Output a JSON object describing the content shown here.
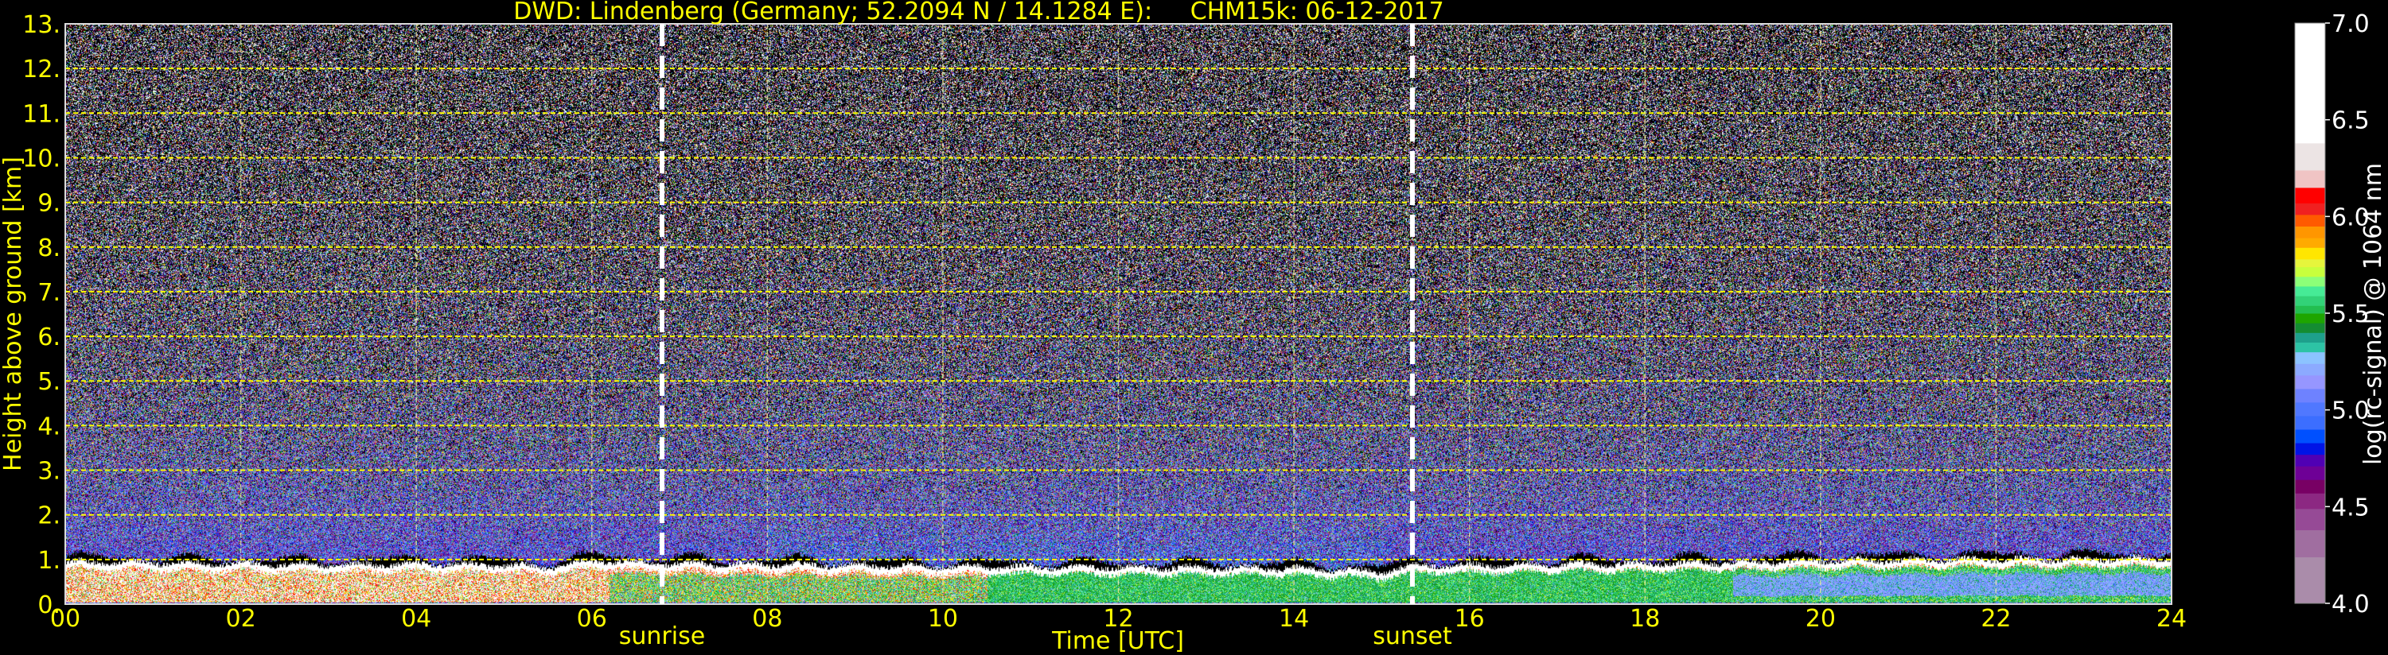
{
  "chart_data": {
    "type": "heatmap",
    "title": "DWD: Lindenberg (Germany; 52.2094 N / 14.1284 E):     CHM15k: 06-12-2017",
    "xlabel": "Time [UTC]",
    "ylabel": "Height above ground [km]",
    "xlim": [
      0,
      24
    ],
    "ylim": [
      0,
      13
    ],
    "grid": true,
    "x_ticks": [
      0,
      2,
      4,
      6,
      8,
      10,
      12,
      14,
      16,
      18,
      20,
      22,
      24
    ],
    "x_tick_labels": [
      "00",
      "02",
      "04",
      "06",
      "08",
      "10",
      "12",
      "14",
      "16",
      "18",
      "20",
      "22",
      "24"
    ],
    "y_ticks": [
      0,
      1,
      2,
      3,
      4,
      5,
      6,
      7,
      8,
      9,
      10,
      11,
      12,
      13
    ],
    "y_tick_labels": [
      "0.",
      "1.",
      "2.",
      "3.",
      "4.",
      "5.",
      "6.",
      "7.",
      "8.",
      "9.",
      "10.",
      "11.",
      "12.",
      "13."
    ],
    "annotations": [
      {
        "label": "sunrise",
        "x": 6.8
      },
      {
        "label": "sunset",
        "x": 15.35
      }
    ],
    "boundary_layer_top_km": [
      [
        0,
        0.92
      ],
      [
        1,
        0.9
      ],
      [
        2,
        0.88
      ],
      [
        3,
        0.85
      ],
      [
        4,
        0.88
      ],
      [
        5,
        0.85
      ],
      [
        5.5,
        0.8
      ],
      [
        6,
        0.95
      ],
      [
        7,
        0.88
      ],
      [
        8,
        0.87
      ],
      [
        9,
        0.85
      ],
      [
        10,
        0.82
      ],
      [
        12,
        0.8
      ],
      [
        14,
        0.78
      ],
      [
        15,
        0.7
      ],
      [
        15.4,
        0.85
      ],
      [
        16,
        0.85
      ],
      [
        18,
        0.88
      ],
      [
        20,
        0.95
      ],
      [
        22,
        0.98
      ],
      [
        24,
        1.0
      ]
    ],
    "colorbar": {
      "label": "log(rc-signal) @ 1064 nm",
      "range": [
        4.0,
        7.0
      ],
      "ticks": [
        4.0,
        4.5,
        5.0,
        5.5,
        6.0,
        6.5,
        7.0
      ],
      "tick_labels": [
        "4.0",
        "4.5",
        "5.0",
        "5.5",
        "6.0",
        "6.5",
        "7.0"
      ],
      "bins": [
        {
          "from": 4.0,
          "color": "#aa8caa"
        },
        {
          "from": 4.24,
          "color": "#a06ea0"
        },
        {
          "from": 4.38,
          "color": "#964a96"
        },
        {
          "from": 4.49,
          "color": "#8c2882"
        },
        {
          "from": 4.57,
          "color": "#780064"
        },
        {
          "from": 4.64,
          "color": "#6e0096"
        },
        {
          "from": 4.71,
          "color": "#5000b4"
        },
        {
          "from": 4.77,
          "color": "#0014e6"
        },
        {
          "from": 4.83,
          "color": "#0050ff"
        },
        {
          "from": 4.9,
          "color": "#3c6eff"
        },
        {
          "from": 4.97,
          "color": "#5078ff"
        },
        {
          "from": 5.04,
          "color": "#6e82ff"
        },
        {
          "from": 5.11,
          "color": "#9696ff"
        },
        {
          "from": 5.18,
          "color": "#8caaff"
        },
        {
          "from": 5.24,
          "color": "#8cc3ff"
        },
        {
          "from": 5.3,
          "color": "#2dc3a5"
        },
        {
          "from": 5.35,
          "color": "#1ea08c"
        },
        {
          "from": 5.4,
          "color": "#148c32"
        },
        {
          "from": 5.45,
          "color": "#1ea500"
        },
        {
          "from": 5.5,
          "color": "#23be50"
        },
        {
          "from": 5.54,
          "color": "#32d278"
        },
        {
          "from": 5.59,
          "color": "#46eb96"
        },
        {
          "from": 5.64,
          "color": "#8cff78"
        },
        {
          "from": 5.69,
          "color": "#c8ff3c"
        },
        {
          "from": 5.74,
          "color": "#e6f53c"
        },
        {
          "from": 5.78,
          "color": "#ffe600"
        },
        {
          "from": 5.84,
          "color": "#ffaa00"
        },
        {
          "from": 5.89,
          "color": "#ff9600"
        },
        {
          "from": 5.95,
          "color": "#ff5a00"
        },
        {
          "from": 6.01,
          "color": "#f02020"
        },
        {
          "from": 6.07,
          "color": "#ff0000"
        },
        {
          "from": 6.15,
          "color": "#f0c4c4"
        },
        {
          "from": 6.24,
          "color": "#ece4e4"
        },
        {
          "from": 6.38,
          "color": "#ffffff"
        }
      ]
    }
  },
  "colors": {
    "text_axis": "#ffff00",
    "text_colorbar": "#ffffff",
    "background": "#000000",
    "grid": "#ffff00"
  }
}
